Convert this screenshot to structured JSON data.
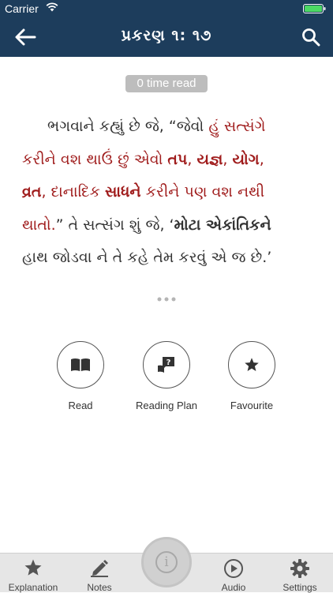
{
  "status_bar": {
    "carrier": "Carrier"
  },
  "nav": {
    "title": "પ્રકરણ ૧: ૧૭"
  },
  "read_count": "0 time read",
  "verse": {
    "l1a": "ભગવાને કહ્યું છે જે, “જેવો ",
    "l1b": "હું  સત્સંગે",
    "l2a": "કરીને વશ થાઉં છું એવો ",
    "l2b": "તપ",
    "l2c": ", ",
    "l2d": "યજ્ઞ",
    "l2e": ", ",
    "l2f": "યોગ",
    "l2g": ",",
    "l3a": "વ્રત",
    "l3b": ", દાનાદિક ",
    "l3c": "સાધને",
    "l3d": " કરીને પણ વશ નથી",
    "l4a": "થાતો.",
    "l4b": "” તે સત્સંગ શું જે, ‘",
    "l4c": "મોટા એકાંતિકને",
    "l5a": "હાથ જોડવા ને તે કહે તેમ કરવું એ જ છે.’"
  },
  "actions": [
    {
      "label": "Read",
      "icon": "book-icon"
    },
    {
      "label": "Reading Plan",
      "icon": "reading-plan-icon"
    },
    {
      "label": "Favourite",
      "icon": "star-icon"
    }
  ],
  "tabs": [
    {
      "label": "Explanation",
      "icon": "star-icon"
    },
    {
      "label": "Notes",
      "icon": "pencil-icon"
    },
    {
      "label": "Audio",
      "icon": "play-icon"
    },
    {
      "label": "Settings",
      "icon": "gear-icon"
    }
  ],
  "center_button": {
    "icon": "info-icon",
    "glyph": "i"
  },
  "colors": {
    "nav_bg": "#1d3d5c",
    "accent_red": "#a01d1d",
    "tab_bg": "#e6e6e6"
  }
}
